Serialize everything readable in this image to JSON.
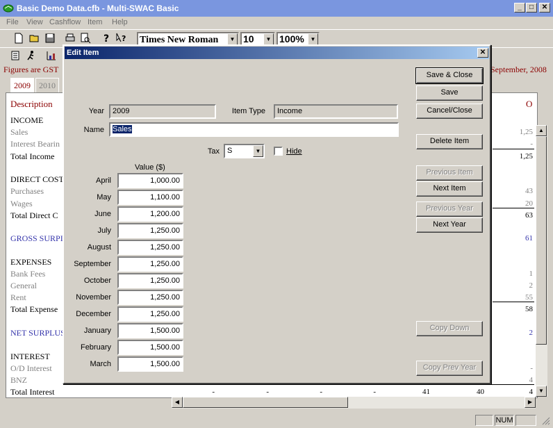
{
  "window": {
    "title": "Basic Demo Data.cfb - Multi-SWAC Basic",
    "minimize": "_",
    "maximize": "□",
    "close": "✕"
  },
  "menu": [
    "File",
    "View",
    "Cashflow",
    "Item",
    "Help"
  ],
  "toolbar": {
    "font_name": "Times New Roman",
    "font_size": "10",
    "zoom": "100%"
  },
  "document": {
    "gst_note_left": "Figures are GST",
    "gst_note_right": "September, 2008",
    "tabs": [
      "2009",
      "2010"
    ],
    "col_header_left": "Description",
    "col_header_right": "O",
    "rows": [
      {
        "label": "INCOME",
        "style": "hdr",
        "value": ""
      },
      {
        "label": "Sales",
        "style": "sub",
        "value": "1,25"
      },
      {
        "label": "Interest Bearin",
        "style": "sub",
        "value": "-"
      },
      {
        "label": "Total Income",
        "style": "hdr",
        "value": "1,25"
      },
      {
        "label": "DIRECT COST",
        "style": "hdr",
        "value": ""
      },
      {
        "label": "Purchases",
        "style": "sub",
        "value": "43"
      },
      {
        "label": "Wages",
        "style": "sub",
        "value": "20"
      },
      {
        "label": "Total Direct C",
        "style": "hdr",
        "value": "63"
      },
      {
        "label": "GROSS SURPI",
        "style": "blue",
        "value": "61"
      },
      {
        "label": "EXPENSES",
        "style": "hdr",
        "value": ""
      },
      {
        "label": "Bank Fees",
        "style": "sub",
        "value": "1"
      },
      {
        "label": "General",
        "style": "sub",
        "value": "2"
      },
      {
        "label": "Rent",
        "style": "sub",
        "value": "55"
      },
      {
        "label": "Total Expense",
        "style": "hdr",
        "value": "58"
      },
      {
        "label": "NET SURPLUS",
        "style": "blue",
        "value": "2"
      },
      {
        "label": "INTEREST",
        "style": "hdr",
        "value": ""
      },
      {
        "label": "O/D Interest",
        "style": "sub",
        "value": "-"
      },
      {
        "label": "BNZ",
        "style": "sub",
        "value": "4"
      },
      {
        "label": "Total Interest",
        "style": "hdr",
        "value": "4"
      }
    ],
    "total_interest_cells": [
      "-",
      "-",
      "-",
      "-",
      "41",
      "40"
    ]
  },
  "status": {
    "num": "NUM"
  },
  "dialog": {
    "title": "Edit Item",
    "close": "✕",
    "year_label": "Year",
    "year_value": "2009",
    "item_type_label": "Item Type",
    "item_type_value": "Income",
    "name_label": "Name",
    "name_value": "Sales",
    "tax_label": "Tax",
    "tax_value": "S",
    "hide_label": "Hide",
    "value_header": "Value ($)",
    "months": [
      {
        "month": "April",
        "value": "1,000.00"
      },
      {
        "month": "May",
        "value": "1,100.00"
      },
      {
        "month": "June",
        "value": "1,200.00"
      },
      {
        "month": "July",
        "value": "1,250.00"
      },
      {
        "month": "August",
        "value": "1,250.00"
      },
      {
        "month": "September",
        "value": "1,250.00"
      },
      {
        "month": "October",
        "value": "1,250.00"
      },
      {
        "month": "November",
        "value": "1,250.00"
      },
      {
        "month": "December",
        "value": "1,250.00"
      },
      {
        "month": "January",
        "value": "1,500.00"
      },
      {
        "month": "February",
        "value": "1,500.00"
      },
      {
        "month": "March",
        "value": "1,500.00"
      }
    ],
    "buttons": {
      "save_close": "Save & Close",
      "save": "Save",
      "cancel_close": "Cancel/Close",
      "delete_item": "Delete Item",
      "previous_item": "Previous Item",
      "next_item": "Next Item",
      "previous_year": "Previous Year",
      "next_year": "Next Year",
      "copy_down": "Copy Down",
      "copy_prev_year": "Copy Prev Year"
    }
  }
}
